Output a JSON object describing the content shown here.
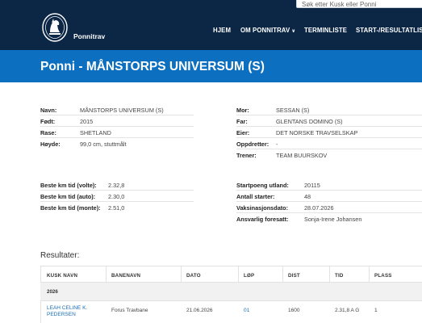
{
  "header": {
    "search_placeholder": "Søk etter Kusk eller Ponni",
    "brand": "Ponnitrav",
    "nav": [
      {
        "label": "HJEM",
        "has_dropdown": false
      },
      {
        "label": "OM PONNITRAV",
        "has_dropdown": true
      },
      {
        "label": "TERMINLISTE",
        "has_dropdown": false
      },
      {
        "label": "START-/RESULTATLIS",
        "has_dropdown": false
      }
    ],
    "colors": {
      "topbar": "#0b2745",
      "title_band": "#0c6fbf",
      "link": "#1a6fb5"
    }
  },
  "page": {
    "title": "Ponni - MÅNSTORPS UNIVERSUM (S)"
  },
  "details_left": [
    {
      "label": "Navn:",
      "value": "MÅNSTORPS UNIVERSUM (S)"
    },
    {
      "label": "Født:",
      "value": "2015"
    },
    {
      "label": "Rase:",
      "value": "SHETLAND"
    },
    {
      "label": "Høyde:",
      "value": "99,0 cm, stuttmålt"
    }
  ],
  "details_right": [
    {
      "label": "Mor:",
      "value": "SESSAN (S)"
    },
    {
      "label": "Far:",
      "value": "GLENTANS DOMINO (S)"
    },
    {
      "label": "Eier:",
      "value": "DET NORSKE TRAVSELSKAP"
    },
    {
      "label": "Oppdretter:",
      "value": "-"
    },
    {
      "label": "Trener:",
      "value": "TEAM BUURSKOV"
    }
  ],
  "stats_left": [
    {
      "label": "Beste km tid (volte):",
      "value": "2.32,8"
    },
    {
      "label": "Beste km tid (auto):",
      "value": "2.30,0"
    },
    {
      "label": "Beste km tid (monte):",
      "value": "2.51,0"
    }
  ],
  "stats_right": [
    {
      "label": "Startpoeng utland:",
      "value": "20115"
    },
    {
      "label": "Antall starter:",
      "value": "48"
    },
    {
      "label": "Vaksinasjonsdato:",
      "value": "28.07.2026"
    },
    {
      "label": "Ansvarlig foresatt:",
      "value": "Sonja-Irene Johansen"
    }
  ],
  "results": {
    "heading": "Resultater:",
    "columns": [
      "KUSK NAVN",
      "BANENAVN",
      "DATO",
      "LØP",
      "DIST",
      "TID",
      "PLASS"
    ],
    "year": "2026",
    "rows": [
      {
        "kusk_line1": "LEAH CELINE K.",
        "kusk_line2": "PEDERSEN",
        "bane": "Forus Travbane",
        "dato": "21.06.2026",
        "lop": "01",
        "dist": "1600",
        "tid": "2.31,8 A G",
        "plass": "1"
      }
    ]
  }
}
